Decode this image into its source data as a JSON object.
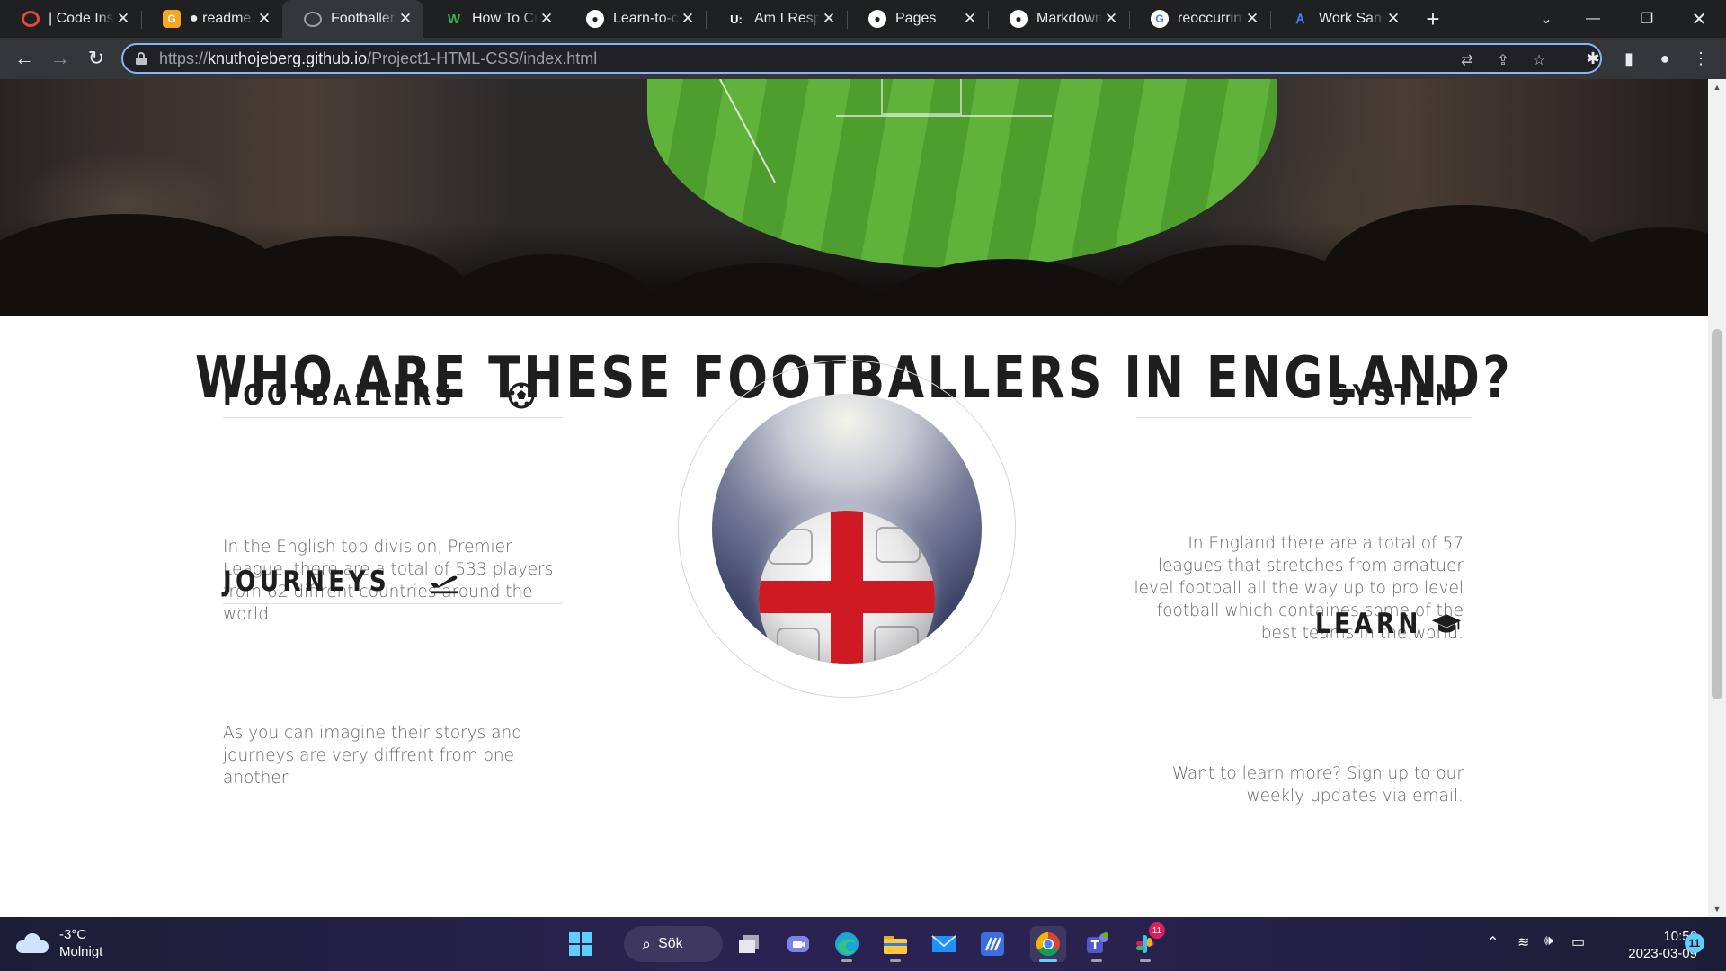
{
  "browser": {
    "tabs": [
      {
        "title": "| Code Institute",
        "favicon": "code-institute-icon",
        "color": "#e8453c"
      },
      {
        "title": "● readme.md",
        "favicon": "gitpod-icon",
        "color": "#f5a623"
      },
      {
        "title": "Footballers",
        "favicon": "globe-icon",
        "color": "#9aa0a6",
        "active": true
      },
      {
        "title": "How To Create",
        "favicon": "w-icon",
        "color": "#39b54a"
      },
      {
        "title": "Learn-to-code",
        "favicon": "github-icon",
        "color": "#ffffff"
      },
      {
        "title": "Am I Responsive",
        "favicon": "ui-icon",
        "color": "#ffffff"
      },
      {
        "title": "Pages",
        "favicon": "github-icon",
        "color": "#ffffff"
      },
      {
        "title": "Markdown",
        "favicon": "github-icon",
        "color": "#ffffff"
      },
      {
        "title": "reoccurring",
        "favicon": "google-icon",
        "color": "#4285f4"
      },
      {
        "title": "Work Sans",
        "favicon": "google-fonts-icon",
        "color": "#4285f4"
      }
    ],
    "url_scheme": "https://",
    "url_host": "knuthojeberg.github.io",
    "url_path": "/Project1-HTML-CSS/index.html",
    "accent": "#8ab4f8"
  },
  "page": {
    "title": "WHO ARE THESE FOOTBALLERS IN ENGLAND?",
    "sections": {
      "footballers": {
        "heading": "FOOTBALLERS",
        "icon": "soccer-ball-icon",
        "text": "In the English top division, Premier League, there are a total of 533 players from 62 diffrent countries around the world."
      },
      "journeys": {
        "heading": "JOURNEYS",
        "icon": "plane-departure-icon",
        "text": "As you can imagine their storys and journeys are very diffrent from one another."
      },
      "system": {
        "heading": "SYSTEM",
        "text": "In England there are a total of 57 leagues that stretches from amatuer level football all the way up to pro level football which containes some of the best teams in the world."
      },
      "learn": {
        "heading": "LEARN",
        "icon": "graduation-cap-icon",
        "text": "Want to learn more? Sign up to our weekly updates via email."
      }
    },
    "text_color": "#666666",
    "heading_color": "#1e1e1e"
  },
  "taskbar": {
    "weather_temp": "-3°C",
    "weather_desc": "Molnigt",
    "search_label": "Sök",
    "time": "10:56",
    "date": "2023-03-09",
    "notification_count": "11",
    "slack_badge": "11"
  }
}
